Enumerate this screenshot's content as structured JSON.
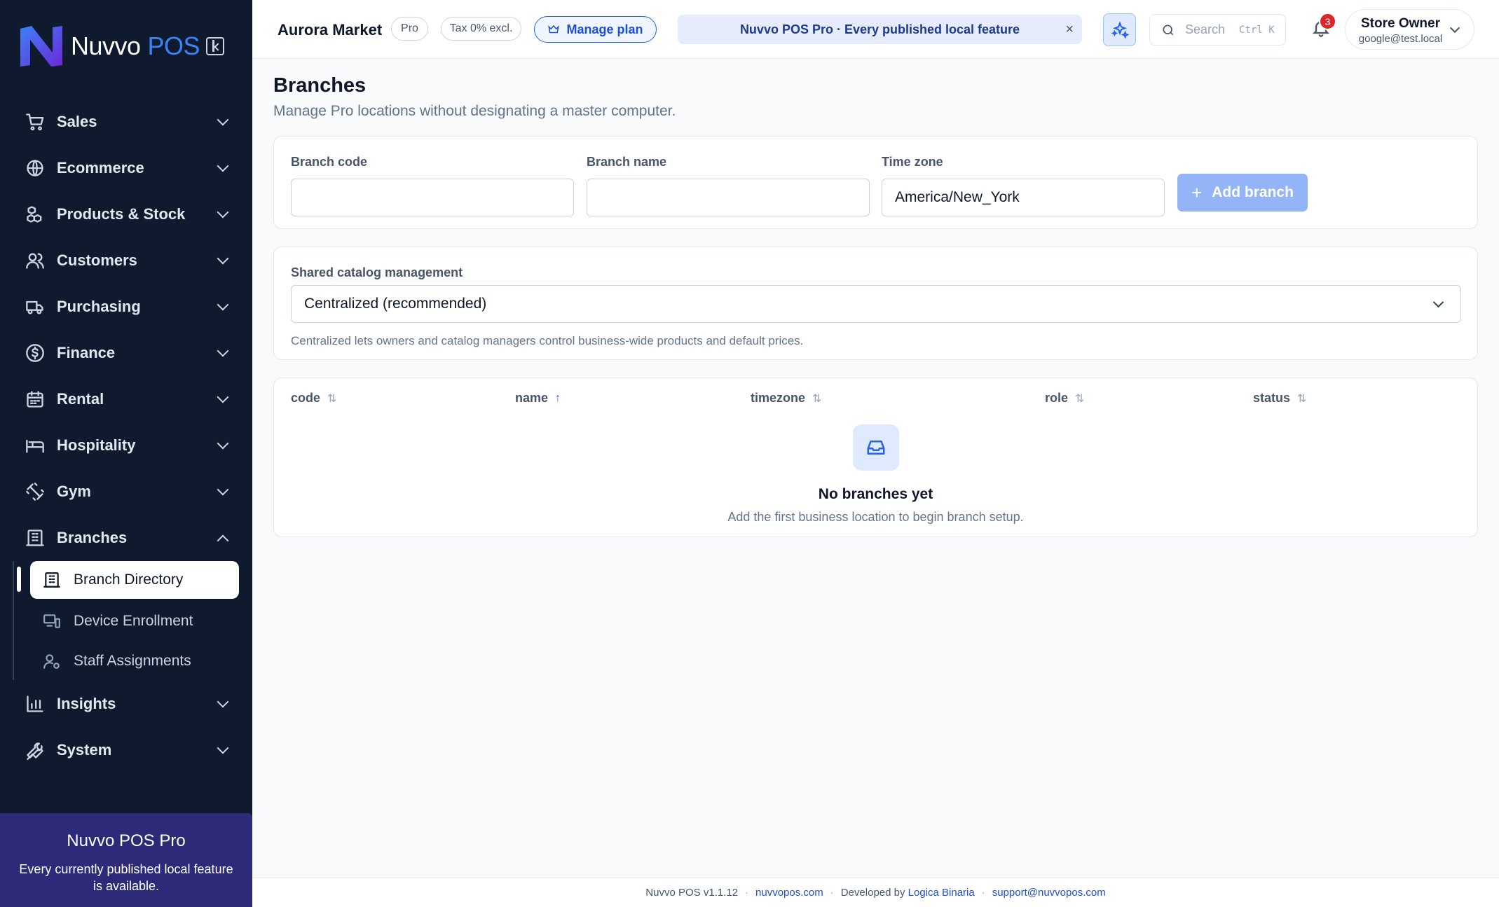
{
  "brand": {
    "name": "Nuvvo",
    "suffix": "POS"
  },
  "sidebar": {
    "items": [
      {
        "label": "Sales",
        "icon": "cart-icon"
      },
      {
        "label": "Ecommerce",
        "icon": "globe-icon"
      },
      {
        "label": "Products & Stock",
        "icon": "boxes-icon"
      },
      {
        "label": "Customers",
        "icon": "users-icon"
      },
      {
        "label": "Purchasing",
        "icon": "truck-icon"
      },
      {
        "label": "Finance",
        "icon": "dollar-icon"
      },
      {
        "label": "Rental",
        "icon": "calendar-icon"
      },
      {
        "label": "Hospitality",
        "icon": "bed-icon"
      },
      {
        "label": "Gym",
        "icon": "dumbbell-icon"
      },
      {
        "label": "Branches",
        "icon": "building-icon",
        "expanded": true
      },
      {
        "label": "Insights",
        "icon": "chart-icon"
      },
      {
        "label": "System",
        "icon": "wrench-icon"
      }
    ],
    "branches_sub": [
      {
        "label": "Branch Directory",
        "icon": "building-icon",
        "active": true
      },
      {
        "label": "Device Enrollment",
        "icon": "devices-icon"
      },
      {
        "label": "Staff Assignments",
        "icon": "user-cog-icon"
      }
    ],
    "promo": {
      "title": "Nuvvo POS Pro",
      "desc": "Every currently published local feature is available."
    }
  },
  "topbar": {
    "store": "Aurora Market",
    "plan_chip": "Pro",
    "tax_chip": "Tax 0% excl.",
    "manage_label": "Manage plan",
    "banner": "Nuvvo POS Pro · Every published local feature",
    "banner_close": "×",
    "search_placeholder": "Search",
    "search_shortcut": "Ctrl K",
    "notifications": "3",
    "user_name": "Store Owner",
    "user_email": "google@test.local"
  },
  "page": {
    "title": "Branches",
    "subtitle": "Manage Pro locations without designating a master computer."
  },
  "form": {
    "code_label": "Branch code",
    "code_value": "",
    "name_label": "Branch name",
    "name_value": "",
    "tz_label": "Time zone",
    "tz_value": "America/New_York",
    "add_label": "Add branch"
  },
  "catalog": {
    "label": "Shared catalog management",
    "value": "Centralized (recommended)",
    "hint": "Centralized lets owners and catalog managers control business-wide products and default prices."
  },
  "table": {
    "columns": [
      {
        "label": "code",
        "sort": "⇅"
      },
      {
        "label": "name",
        "sort": "↑"
      },
      {
        "label": "timezone",
        "sort": "⇅"
      },
      {
        "label": "role",
        "sort": "⇅"
      },
      {
        "label": "status",
        "sort": "⇅"
      }
    ],
    "empty_title": "No branches yet",
    "empty_desc": "Add the first business location to begin branch setup."
  },
  "footer": {
    "version": "Nuvvo POS v1.1.12",
    "site": "nuvvopos.com",
    "dev_prefix": "Developed by",
    "dev": "Logica Binaria",
    "support": "support@nuvvopos.com",
    "sep": "·"
  },
  "colors": {
    "sidebar": "#0f1a2e",
    "accent": "#2563eb",
    "promo": "#2e2a7a",
    "badge": "#dc2626"
  }
}
